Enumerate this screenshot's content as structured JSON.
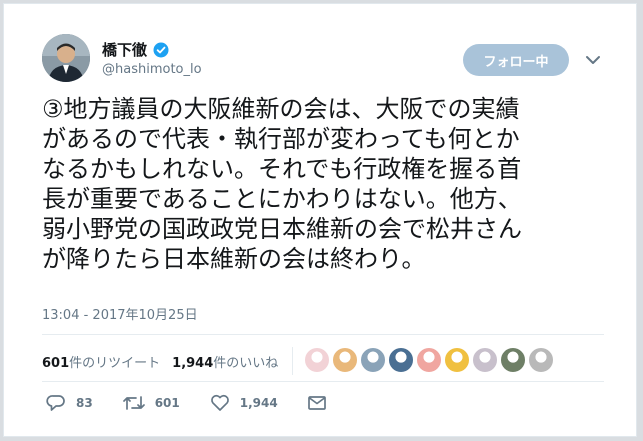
{
  "tweet": {
    "author": {
      "display_name": "橋下徹",
      "handle": "@hashimoto_lo",
      "verified": true
    },
    "follow_button_label": "フォロー中",
    "text": "③地方議員の大阪維新の会は、大阪での実績\nがあるので代表・執行部が変わっても何とか\nなるかもしれない。それでも行政権を握る首\n長が重要であることにかわりはない。他方、\n弱小野党の国政政党日本維新の会で松井さん\nが降りたら日本維新の会は終わり。",
    "timestamp": "13:04 - 2017年10月25日",
    "retweet_count": "601",
    "retweet_label": "件のリツイート",
    "like_count": "1,944",
    "like_label": "件のいいね",
    "actions": {
      "reply_count": "83",
      "retweet_count": "601",
      "like_count": "1,944"
    },
    "liker_avatar_colors": [
      "#f2d2d6",
      "#e9b87a",
      "#8aa3b8",
      "#4a6f93",
      "#f0a6a0",
      "#f0c040",
      "#c8c0cc",
      "#6e7f66",
      "#b9b9b9"
    ]
  },
  "colors": {
    "follow_bg": "#a9c3d9",
    "verified_blue": "#1da1f2",
    "muted_text": "#657786"
  }
}
